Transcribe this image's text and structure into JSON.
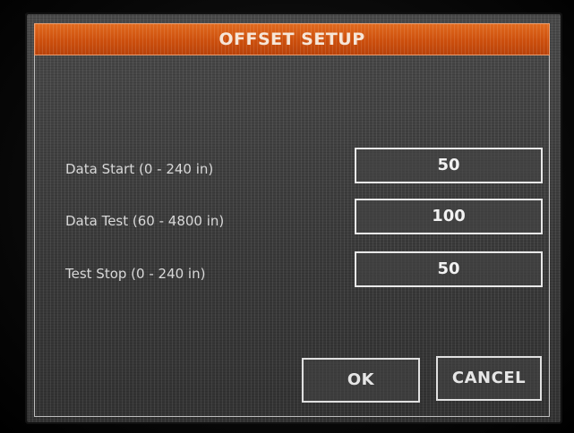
{
  "window": {
    "title": "OFFSET SETUP"
  },
  "form": {
    "fields": [
      {
        "label": "Data Start (0 - 240 in)",
        "value": "50"
      },
      {
        "label": "Data Test (60 - 4800 in)",
        "value": "100"
      },
      {
        "label": "Test Stop (0 - 240 in)",
        "value": "50"
      }
    ]
  },
  "buttons": {
    "ok_label": "OK",
    "cancel_label": "CANCEL"
  },
  "colors": {
    "title_bar": "#cc4f0d",
    "background": "#3d3d3d",
    "text": "#d8d8d8"
  }
}
